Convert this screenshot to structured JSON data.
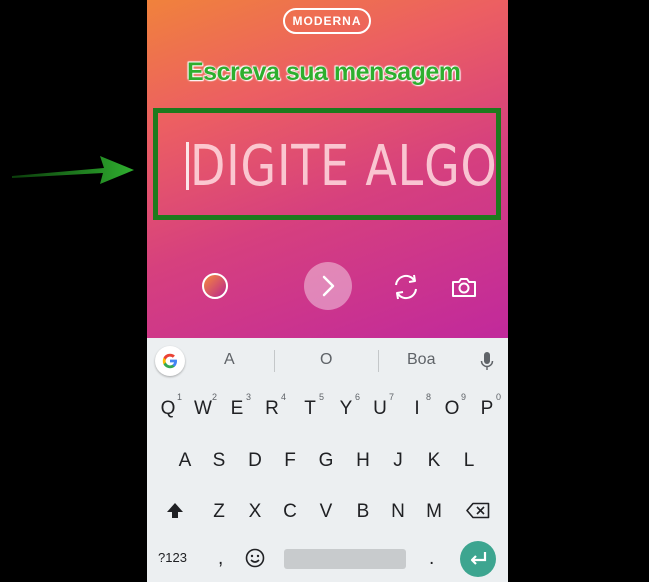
{
  "story": {
    "font_style": "MODERNA",
    "annotation": "Escreva sua mensagem",
    "placeholder": "DIGITE ALGO"
  },
  "keyboard": {
    "suggestions": [
      "A",
      "O",
      "Boa"
    ],
    "row1": [
      {
        "k": "Q",
        "n": "1"
      },
      {
        "k": "W",
        "n": "2"
      },
      {
        "k": "E",
        "n": "3"
      },
      {
        "k": "R",
        "n": "4"
      },
      {
        "k": "T",
        "n": "5"
      },
      {
        "k": "Y",
        "n": "6"
      },
      {
        "k": "U",
        "n": "7"
      },
      {
        "k": "I",
        "n": "8"
      },
      {
        "k": "O",
        "n": "9"
      },
      {
        "k": "P",
        "n": "0"
      }
    ],
    "row2": [
      "A",
      "S",
      "D",
      "F",
      "G",
      "H",
      "J",
      "K",
      "L"
    ],
    "row3": [
      "Z",
      "X",
      "C",
      "V",
      "B",
      "N",
      "M"
    ],
    "symbols_key": "?123",
    "comma_key": ",",
    "period_key": "."
  },
  "colors": {
    "annotation_green": "#2eae2e",
    "highlight_border": "#1d7a1d",
    "enter_key": "#3da590"
  }
}
